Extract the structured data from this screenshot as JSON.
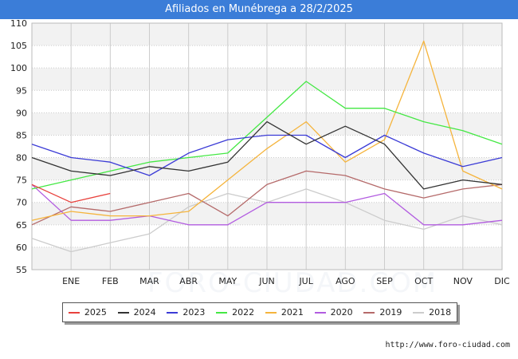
{
  "header": {
    "title": "Afiliados en Munébrega a 28/2/2025"
  },
  "footer": {
    "source": "http://www.foro-ciudad.com"
  },
  "watermark": {
    "text": "FORO-CIUDAD.COM"
  },
  "colors": {
    "title_bg": "#3b7dd8",
    "band": "#f2f2f2",
    "grid": "#cccccc"
  },
  "chart_data": {
    "type": "line",
    "title": "Afiliados en Munébrega a 28/2/2025",
    "categories": [
      "",
      "ENE",
      "FEB",
      "MAR",
      "ABR",
      "MAY",
      "JUN",
      "JUL",
      "AGO",
      "SEP",
      "OCT",
      "NOV",
      "DIC"
    ],
    "ylim": [
      55,
      110
    ],
    "yticks": [
      55,
      60,
      65,
      70,
      75,
      80,
      85,
      90,
      95,
      100,
      105,
      110
    ],
    "grid": true,
    "legend_position": "bottom",
    "series": [
      {
        "name": "2025",
        "color": "#e8413c",
        "values": [
          74,
          70,
          72
        ]
      },
      {
        "name": "2024",
        "color": "#333333",
        "values": [
          80,
          77,
          76,
          78,
          77,
          79,
          88,
          83,
          87,
          83,
          73,
          75,
          74
        ]
      },
      {
        "name": "2023",
        "color": "#3b3bd6",
        "values": [
          83,
          80,
          79,
          76,
          81,
          84,
          85,
          85,
          80,
          85,
          81,
          78,
          80
        ]
      },
      {
        "name": "2022",
        "color": "#44e844",
        "values": [
          73,
          75,
          77,
          79,
          80,
          81,
          89,
          97,
          91,
          91,
          88,
          86,
          83
        ]
      },
      {
        "name": "2021",
        "color": "#f5b43c",
        "values": [
          66,
          68,
          67,
          67,
          68,
          75,
          82,
          88,
          79,
          84,
          106,
          77,
          73
        ]
      },
      {
        "name": "2020",
        "color": "#b25ce0",
        "values": [
          74,
          66,
          66,
          67,
          65,
          65,
          70,
          70,
          70,
          72,
          65,
          65,
          66
        ]
      },
      {
        "name": "2019",
        "color": "#b56a6a",
        "values": [
          65,
          69,
          68,
          70,
          72,
          67,
          74,
          77,
          76,
          73,
          71,
          73,
          74
        ]
      },
      {
        "name": "2018",
        "color": "#cccccc",
        "values": [
          62,
          59,
          61,
          63,
          69,
          72,
          70,
          73,
          70,
          66,
          64,
          67,
          65
        ]
      }
    ]
  }
}
